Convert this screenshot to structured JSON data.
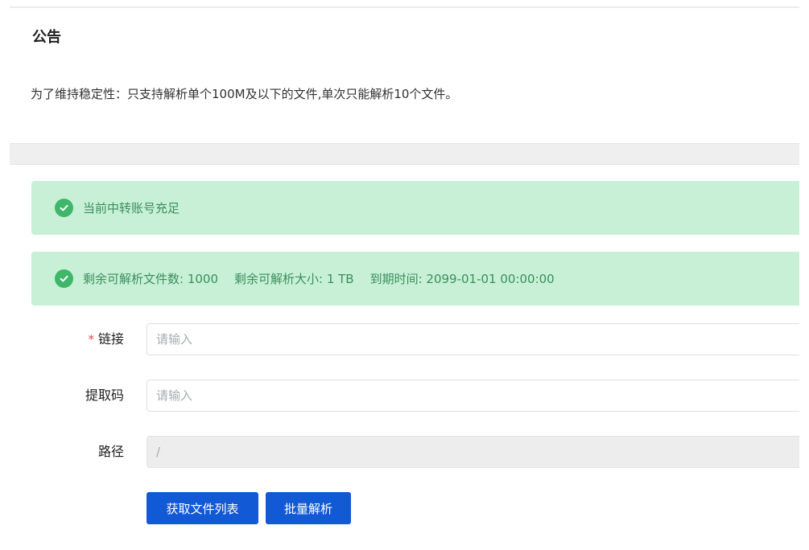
{
  "notice": {
    "title": "公告",
    "text": "为了维持稳定性：只支持解析单个100M及以下的文件,单次只能解析10个文件。"
  },
  "alerts": {
    "account_status": "当前中转账号充足",
    "remaining_files": "剩余可解析文件数: 1000",
    "remaining_size": "剩余可解析大小: 1 TB",
    "expire_time": "到期时间: 2099-01-01 00:00:00"
  },
  "form": {
    "link": {
      "required_mark": "*",
      "label": "链接",
      "placeholder": "请输入",
      "value": ""
    },
    "code": {
      "label": "提取码",
      "placeholder": "请输入",
      "value": ""
    },
    "path": {
      "label": "路径",
      "value": "/"
    }
  },
  "buttons": {
    "get_list": "获取文件列表",
    "batch_parse": "批量解析"
  },
  "colors": {
    "alert_bg": "#c8f0d7",
    "success": "#3fb66a",
    "primary": "#1259d6",
    "required": "#e5484d"
  },
  "icons": {
    "alert_icon": "check-circle-icon"
  }
}
